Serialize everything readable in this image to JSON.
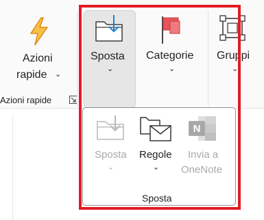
{
  "ribbon": {
    "quick_actions": {
      "label_line1": "Azioni",
      "label_line2": "rapide",
      "icon": "lightning-icon"
    },
    "quick_actions_group": {
      "label": "Azioni rapide",
      "launcher_icon": "dialog-launcher-icon"
    },
    "move": {
      "label": "Sposta",
      "icon": "move-to-folder-icon"
    },
    "categories": {
      "label": "Categorie",
      "icon": "flag-icon"
    },
    "groups": {
      "label": "Gruppi",
      "icon": "groups-icon"
    }
  },
  "popup": {
    "items": [
      {
        "label_line1": "Sposta",
        "label_line2": "",
        "icon": "move-to-folder-icon",
        "disabled": true
      },
      {
        "label_line1": "Regole",
        "label_line2": "",
        "icon": "rules-envelope-icon",
        "disabled": false
      },
      {
        "label_line1": "Invia a",
        "label_line2": "OneNote",
        "icon": "onenote-icon",
        "disabled": true
      }
    ],
    "group_label": "Sposta"
  },
  "colors": {
    "highlight_border": "#e21b23",
    "lightning": "#f2a31b",
    "flag": "#e8545a",
    "move_arrow": "#1a7fd4",
    "disabled_text": "#a9a9a9"
  }
}
